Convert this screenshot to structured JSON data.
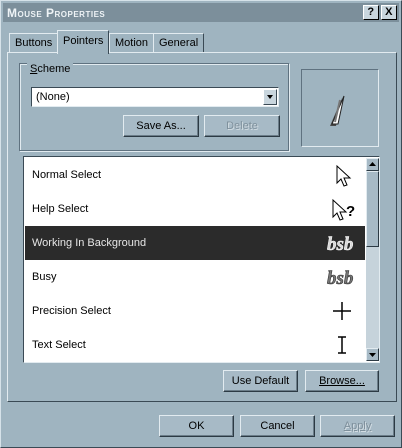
{
  "window": {
    "title": "Mouse Properties",
    "help_label": "?",
    "close_label": "X"
  },
  "tabs": [
    {
      "label": "Buttons"
    },
    {
      "label": "Pointers"
    },
    {
      "label": "Motion"
    },
    {
      "label": "General"
    }
  ],
  "active_tab": "Pointers",
  "scheme": {
    "group_label_first": "S",
    "group_label_rest": "cheme",
    "selected_value": "(None)",
    "save_as_label": "Save As...",
    "delete_label": "Delete"
  },
  "preview": {
    "icon": "working-in-background-cursor-icon"
  },
  "pointers": [
    {
      "label": "Normal Select",
      "icon": "arrow-cursor-icon"
    },
    {
      "label": "Help Select",
      "icon": "help-cursor-icon"
    },
    {
      "label": "Working In Background",
      "icon": "working-background-cursor-icon",
      "selected": true
    },
    {
      "label": "Busy",
      "icon": "busy-cursor-icon"
    },
    {
      "label": "Precision Select",
      "icon": "crosshair-cursor-icon"
    },
    {
      "label": "Text Select",
      "icon": "ibeam-cursor-icon"
    }
  ],
  "list_buttons": {
    "use_default_label": "Use Default",
    "browse_label": "Browse..."
  },
  "footer": {
    "ok_label": "OK",
    "cancel_label": "Cancel",
    "apply_label": "Apply"
  },
  "colors": {
    "face": "#9fb4c0",
    "titlebar": "#7c8f9b",
    "selection": "#2b2b2b"
  }
}
